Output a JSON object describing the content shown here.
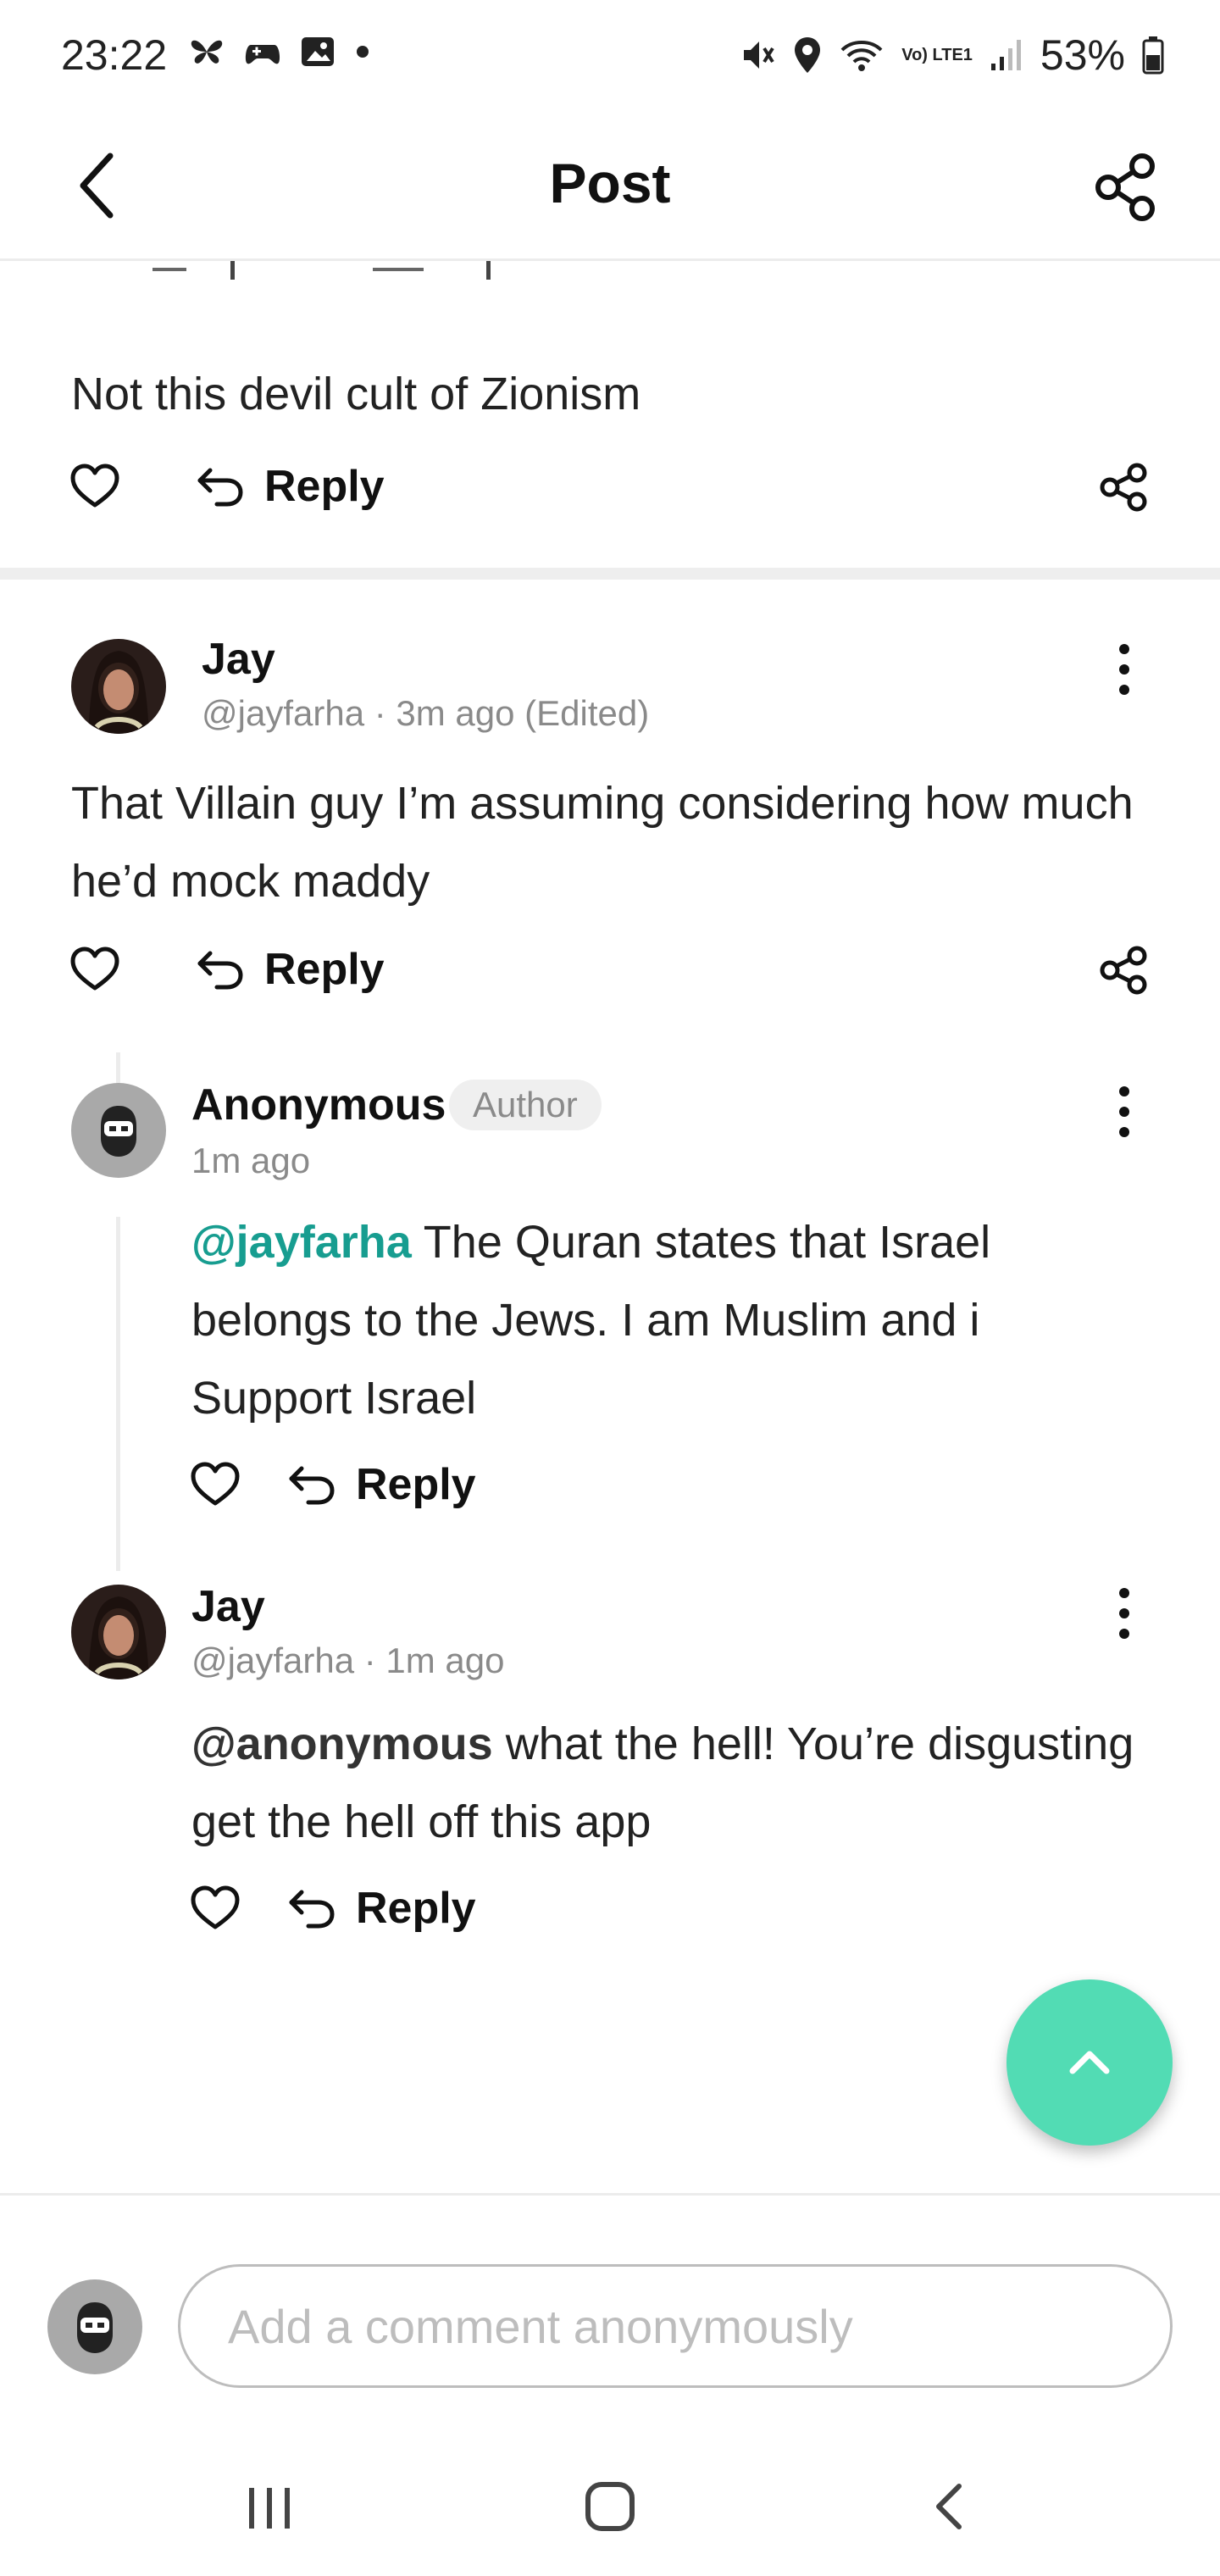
{
  "status_bar": {
    "time": "23:22",
    "battery": "53%",
    "network_label": "Vo) LTE1"
  },
  "header": {
    "title": "Post"
  },
  "top_comment": {
    "text": "Not this devil cult of Zionism",
    "reply_label": "Reply"
  },
  "comments": [
    {
      "name": "Jay",
      "handle": "@jayfarha",
      "time": "3m ago",
      "edited": "(Edited)",
      "text": "That Villain guy I’m assuming considering how much he’d mock maddy",
      "reply_label": "Reply"
    }
  ],
  "replies": [
    {
      "name": "Anonymous",
      "badge": "Author",
      "time": "1m ago",
      "mention": "@jayfarha",
      "text": " The Quran states that Israel belongs to the Jews. I am Muslim and i Support Israel",
      "reply_label": "Reply"
    },
    {
      "name": "Jay",
      "handle": "@jayfarha",
      "time": "1m ago",
      "mention": "@anonymous",
      "text": " what the hell! You’re disgusting get the hell off this app",
      "reply_label": "Reply"
    }
  ],
  "composer": {
    "placeholder": "Add a comment anonymously"
  },
  "colors": {
    "accent_mint": "#52dcb4",
    "mention_teal": "#179d90",
    "meta_gray": "#8a8a8a"
  },
  "icons": [
    "back-icon",
    "share-icon",
    "heart-icon",
    "reply-icon",
    "kebab-icon",
    "chevron-up-icon",
    "anonymous-avatar-icon"
  ]
}
